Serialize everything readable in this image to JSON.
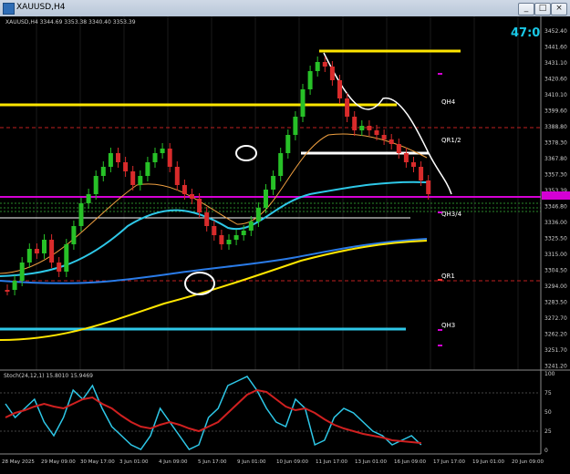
{
  "window": {
    "title": "XAUUSD,H4",
    "buttons": [
      "_",
      "□",
      "×"
    ]
  },
  "chart": {
    "header": "XAUUSD,H4  3344.69 3353.38 3340.40 3353.39",
    "timer": "47:09",
    "colors": {
      "background": "#000000",
      "up_candle": "#27c127",
      "down_candle": "#d92b2b",
      "yellow_level": "#ffe600",
      "magenta_level": "#d400d4",
      "cyan_level": "#2ec8e8",
      "red_dashed": "#c02020"
    },
    "price_labels": [
      "3452.40",
      "3441.60",
      "3431.10",
      "3420.60",
      "3410.10",
      "3399.60",
      "3388.80",
      "3378.30",
      "3367.80",
      "3357.30",
      "3353.39",
      "3346.80",
      "3336.00",
      "3325.50",
      "3315.00",
      "3304.50",
      "3294.00",
      "3283.50",
      "3272.70",
      "3262.20",
      "3251.70",
      "3241.20"
    ],
    "time_labels": [
      "28 May 2025",
      "29 May 09:00",
      "30 May 17:00",
      "3 Jun 01:00",
      "4 Jun 09:00",
      "5 Jun 17:00",
      "9 Jun 01:00",
      "10 Jun 09:00",
      "11 Jun 17:00",
      "13 Jun 01:00",
      "16 Jun 09:00",
      "17 Jun 17:00",
      "19 Jun 01:00",
      "20 Jun 09:00"
    ],
    "level_labels": [
      "QH4",
      "QR1/2",
      "QH3/4",
      "QR1",
      "QH3"
    ],
    "stoch": {
      "label": "Stoch(24,12,1) 15.8010 15.9469",
      "scale": [
        "100",
        "75",
        "50",
        "25",
        "0"
      ]
    }
  }
}
